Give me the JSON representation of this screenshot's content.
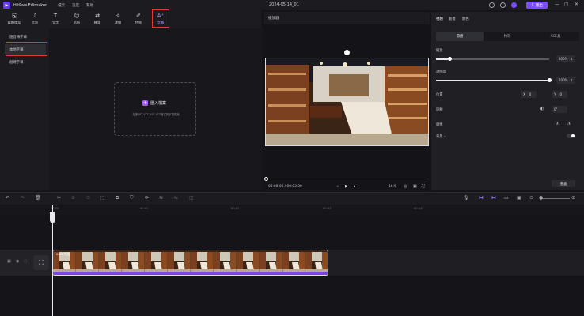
{
  "titlebar": {
    "app_name": "HitPaw Edimakor",
    "menu": [
      "檔案",
      "設定",
      "幫助"
    ],
    "doc_title": "2024-05-14_01",
    "export_label": "匯出"
  },
  "toolbar": {
    "tools": [
      {
        "label": "媒體檔案",
        "icon": "media-icon"
      },
      {
        "label": "音訊",
        "icon": "music-icon"
      },
      {
        "label": "文字",
        "icon": "text-icon"
      },
      {
        "label": "貼紙",
        "icon": "sticker-icon"
      },
      {
        "label": "轉場",
        "icon": "transition-icon"
      },
      {
        "label": "濾鏡",
        "icon": "filter-icon"
      },
      {
        "label": "特效",
        "icon": "effect-icon"
      },
      {
        "label": "字幕",
        "icon": "subtitle-icon",
        "active": true
      }
    ]
  },
  "sidebar": {
    "items": [
      "語音轉字幕",
      "本地字幕",
      "創建字幕"
    ],
    "selected_index": 1
  },
  "media": {
    "import_label": "匯入檔案",
    "import_hint": "支援SRT,VTT,ASS,VTT格式的字幕檔案"
  },
  "player": {
    "title": "播放器",
    "timecode": "00:00:00 / 00:03:00",
    "ratio": "16:9"
  },
  "right_panel": {
    "tabs": [
      "視頻",
      "動畫",
      "顏色"
    ],
    "segments": [
      "常用",
      "特效",
      "AI工具"
    ],
    "scale_label": "縮放",
    "scale_value": "100%",
    "scale_fraction": 0.12,
    "opacity_label": "透明度",
    "opacity_value": "100%",
    "opacity_fraction": 1.0,
    "position_label": "位置",
    "x_label": "X",
    "x_value": "0",
    "y_label": "Y",
    "y_value": "0",
    "rotate_label": "旋轉",
    "rotate_value": "0°",
    "flip_label": "鏡像",
    "background_label": "背景",
    "reset_label": "重置"
  },
  "timeline": {
    "ticks": [
      "00:00",
      "00:01",
      "00:02",
      "00:03",
      "00:04"
    ],
    "clip_label": "0.03 片段"
  },
  "colors": {
    "accent": "#7c4dff",
    "highlight": "#e53935"
  }
}
